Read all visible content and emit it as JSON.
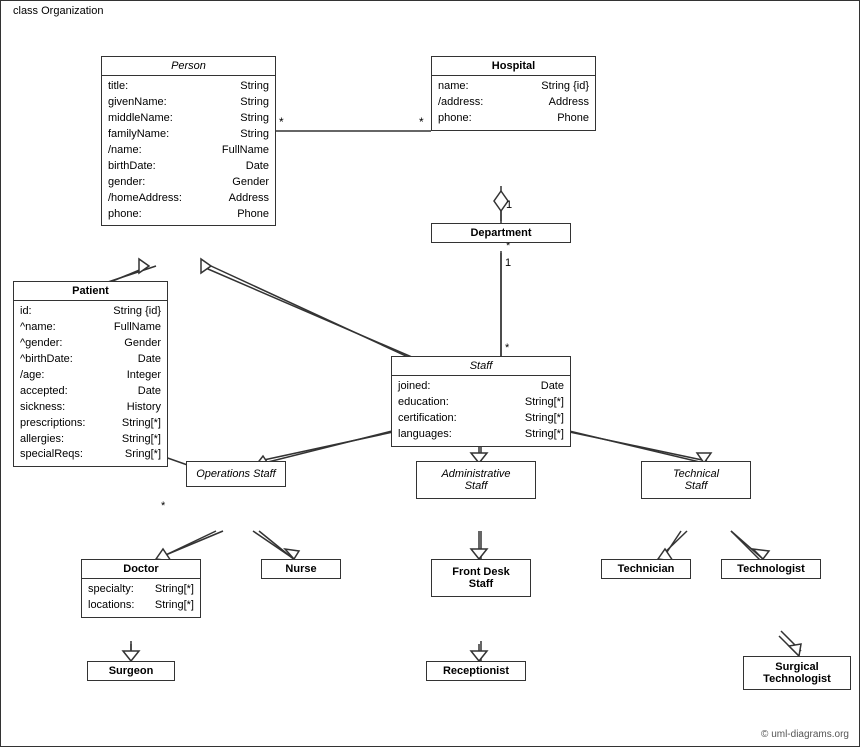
{
  "diagram": {
    "title": "class Organization",
    "classes": {
      "person": {
        "name": "Person",
        "italic": true,
        "attributes": [
          [
            "title:",
            "String"
          ],
          [
            "givenName:",
            "String"
          ],
          [
            "middleName:",
            "String"
          ],
          [
            "familyName:",
            "String"
          ],
          [
            "/name:",
            "FullName"
          ],
          [
            "birthDate:",
            "Date"
          ],
          [
            "gender:",
            "Gender"
          ],
          [
            "/homeAddress:",
            "Address"
          ],
          [
            "phone:",
            "Phone"
          ]
        ]
      },
      "hospital": {
        "name": "Hospital",
        "italic": false,
        "attributes": [
          [
            "name:",
            "String {id}"
          ],
          [
            "/address:",
            "Address"
          ],
          [
            "phone:",
            "Phone"
          ]
        ]
      },
      "patient": {
        "name": "Patient",
        "italic": false,
        "attributes": [
          [
            "id:",
            "String {id}"
          ],
          [
            "^name:",
            "FullName"
          ],
          [
            "^gender:",
            "Gender"
          ],
          [
            "^birthDate:",
            "Date"
          ],
          [
            "/age:",
            "Integer"
          ],
          [
            "accepted:",
            "Date"
          ],
          [
            "sickness:",
            "History"
          ],
          [
            "prescriptions:",
            "String[*]"
          ],
          [
            "allergies:",
            "String[*]"
          ],
          [
            "specialReqs:",
            "Sring[*]"
          ]
        ]
      },
      "department": {
        "name": "Department",
        "italic": false,
        "attributes": []
      },
      "staff": {
        "name": "Staff",
        "italic": true,
        "attributes": [
          [
            "joined:",
            "Date"
          ],
          [
            "education:",
            "String[*]"
          ],
          [
            "certification:",
            "String[*]"
          ],
          [
            "languages:",
            "String[*]"
          ]
        ]
      },
      "operations_staff": {
        "name": "Operations Staff",
        "italic": true,
        "attributes": []
      },
      "administrative_staff": {
        "name": "Administrative Staff",
        "italic": true,
        "attributes": []
      },
      "technical_staff": {
        "name": "Technical Staff",
        "italic": true,
        "attributes": []
      },
      "doctor": {
        "name": "Doctor",
        "italic": false,
        "attributes": [
          [
            "specialty:",
            "String[*]"
          ],
          [
            "locations:",
            "String[*]"
          ]
        ]
      },
      "nurse": {
        "name": "Nurse",
        "italic": false,
        "attributes": []
      },
      "front_desk_staff": {
        "name": "Front Desk Staff",
        "italic": false,
        "attributes": []
      },
      "technician": {
        "name": "Technician",
        "italic": false,
        "attributes": []
      },
      "technologist": {
        "name": "Technologist",
        "italic": false,
        "attributes": []
      },
      "surgeon": {
        "name": "Surgeon",
        "italic": false,
        "attributes": []
      },
      "receptionist": {
        "name": "Receptionist",
        "italic": false,
        "attributes": []
      },
      "surgical_technologist": {
        "name": "Surgical Technologist",
        "italic": false,
        "attributes": []
      }
    },
    "copyright": "© uml-diagrams.org"
  }
}
